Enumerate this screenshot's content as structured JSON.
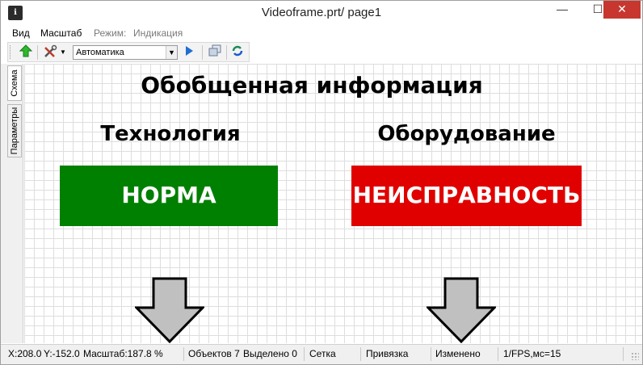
{
  "window": {
    "title": "Videoframe.prt/ page1",
    "app_icon": "app-logo-icon",
    "min_label": "—",
    "max_label": "☐",
    "close_label": "✕"
  },
  "menu": {
    "view": "Вид",
    "scale": "Масштаб",
    "mode": "Режим:",
    "indication": "Индикация"
  },
  "toolbar": {
    "up_icon": "green-up-arrow-icon",
    "tools_icon": "tools-icon",
    "mode_select_value": "Автоматика",
    "play_icon": "play-icon",
    "windows_icon": "windows-icon",
    "refresh_icon": "refresh-icon"
  },
  "sidetabs": {
    "schema": "Схема",
    "params": "Параметры"
  },
  "canvas": {
    "title": "Обобщенная информация",
    "left_heading": "Технология",
    "right_heading": "Оборудование",
    "left_status": "НОРМА",
    "right_status": "НЕИСПРАВНОСТЬ",
    "colors": {
      "ok": "#008000",
      "fault": "#e00000",
      "arrow_fill": "#c0c0c0"
    }
  },
  "statusbar": {
    "x": "X:208.0",
    "y": "Y:-152.0",
    "zoom": "Масштаб:187.8 %",
    "objects": "Объектов 7",
    "selected": "Выделено 0",
    "grid": "Сетка",
    "snap": "Привязка",
    "changed": "Изменено",
    "fps": "1/FPS,мс=15"
  }
}
